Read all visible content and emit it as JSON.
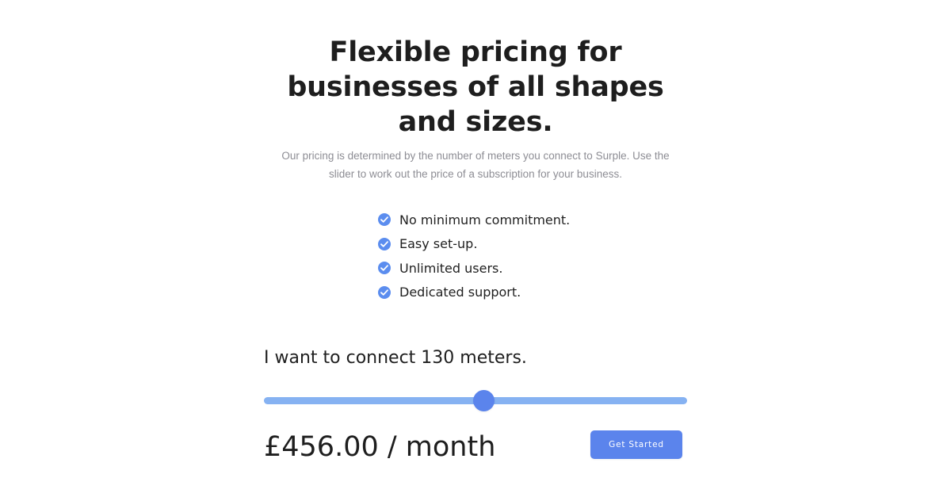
{
  "hero": {
    "headline_lines": [
      "Flexible pricing for",
      "businesses of all shapes",
      "and sizes."
    ],
    "subtitle_lines": [
      "Our pricing is determined by the number of meters you connect to Surple. Use the",
      "slider to work out the price of a subscription for your business."
    ]
  },
  "features": {
    "items": [
      {
        "label": "No minimum commitment.",
        "icon": "check-circle-icon"
      },
      {
        "label": "Easy set-up.",
        "icon": "check-circle-icon"
      },
      {
        "label": "Unlimited users.",
        "icon": "check-circle-icon"
      },
      {
        "label": "Dedicated support.",
        "icon": "check-circle-icon"
      }
    ]
  },
  "calculator": {
    "connect_text": "I want to connect 130 meters.",
    "slider_position": 0.52,
    "price_text": "£456.00 / month",
    "cta_label": "Get Started"
  },
  "colors": {
    "accent": "#5b84ec",
    "track": "#86b2f2",
    "heading": "#1e1e1e",
    "muted_text": "#8d8d94"
  }
}
